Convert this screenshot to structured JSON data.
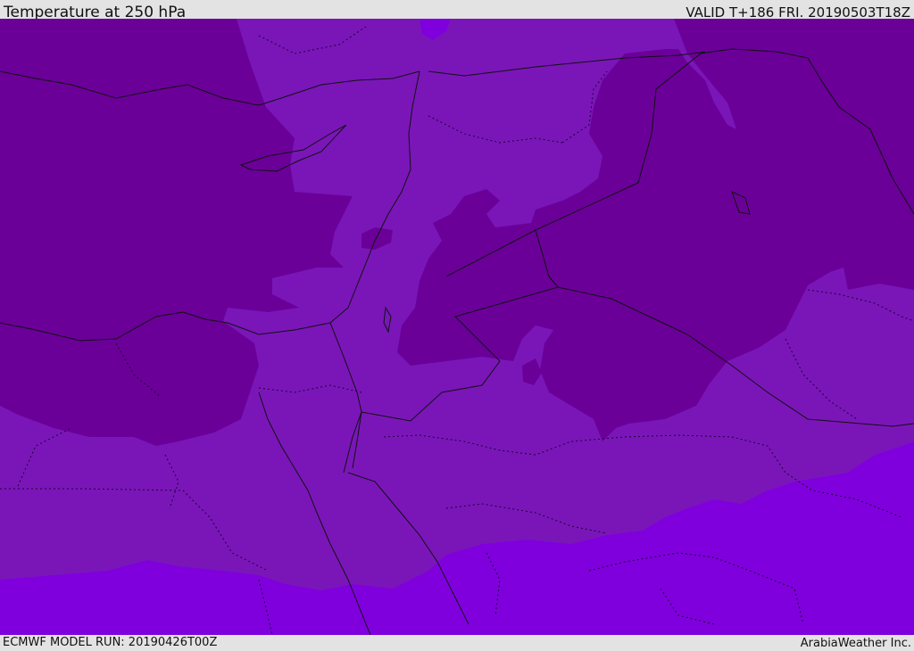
{
  "header": {
    "title": "Temperature at 250 hPa",
    "valid": "VALID T+186 FRI. 20190503T18Z"
  },
  "footer": {
    "model_run": "ECMWF MODEL RUN: 20190426T00Z",
    "credit": "ArabiaWeather Inc."
  },
  "map": {
    "fill_colors": {
      "cold": "#6a0098",
      "mid": "#7a16b8",
      "warm": "#7f00dd"
    },
    "line_color": "#111111"
  }
}
